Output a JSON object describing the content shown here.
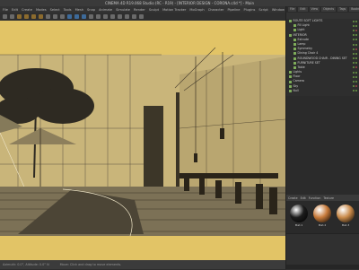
{
  "window": {
    "title": "CINEMA 4D R19.068 Studio (RC - R19) - [INTERIOR DESIGN - CORONA.c4d *] - Main"
  },
  "menu": [
    "File",
    "Edit",
    "Create",
    "Modes",
    "Select",
    "Tools",
    "Mesh",
    "Snap",
    "Animate",
    "Simulate",
    "Render",
    "Sculpt",
    "Motion Tracker",
    "MoGraph",
    "Character",
    "Pipeline",
    "Plugins",
    "Script",
    "Window",
    "Help"
  ],
  "viewport": {
    "background": "#e2c466"
  },
  "statusbar": {
    "left": "Azimuth: 0.0°, Altitude: 0.0° N",
    "right": "Move: Click and drag to move elements."
  },
  "panel": {
    "object_tabs": [
      "File",
      "Edit",
      "View",
      "Objects",
      "Tags",
      "Bookmarks"
    ],
    "objects": [
      {
        "name": "ROUTE SOFT LIGHTS",
        "depth": 0
      },
      {
        "name": "Fill Light",
        "depth": 1
      },
      {
        "name": "Light",
        "depth": 1
      },
      {
        "name": "INTERIOR",
        "depth": 0
      },
      {
        "name": "Extrude",
        "depth": 1
      },
      {
        "name": "Lamp",
        "depth": 1
      },
      {
        "name": "Symmetry",
        "depth": 1
      },
      {
        "name": "Dining Chair 4",
        "depth": 1
      },
      {
        "name": "ROUNDWOOD CHAIR - DINING SET",
        "depth": 1
      },
      {
        "name": "FURNITURE SET",
        "depth": 1
      },
      {
        "name": "Table",
        "depth": 1
      },
      {
        "name": "Lights",
        "depth": 0
      },
      {
        "name": "Floor",
        "depth": 0
      },
      {
        "name": "Camera",
        "depth": 0
      },
      {
        "name": "Sky",
        "depth": 0
      },
      {
        "name": "Null",
        "depth": 0
      }
    ],
    "material_tabs": [
      "Create",
      "Edit",
      "Function",
      "Texture"
    ],
    "materials": [
      {
        "name": "Mat.1",
        "color": "#1c1c1c"
      },
      {
        "name": "Mat.2",
        "color": "#c77a3a"
      },
      {
        "name": "Mat.3",
        "color": "#c98a4a"
      }
    ]
  }
}
